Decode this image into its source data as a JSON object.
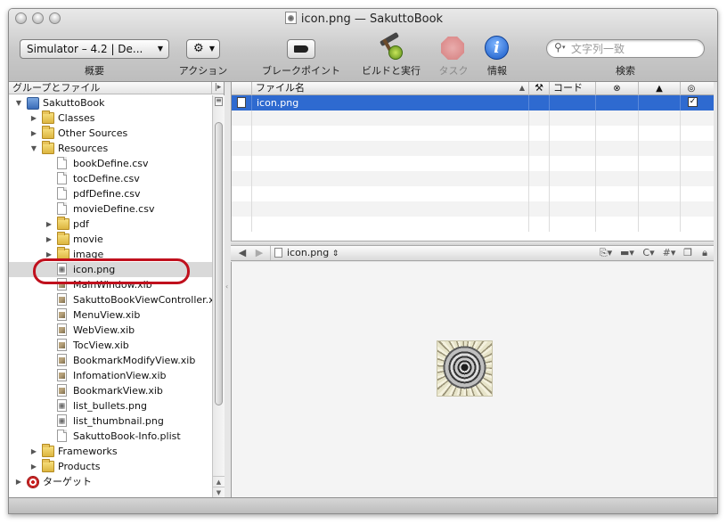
{
  "window": {
    "title": "icon.png — SakuttoBook"
  },
  "toolbar": {
    "scheme_popup": "Simulator – 4.2 | De...",
    "scheme_label": "概要",
    "action_label": "アクション",
    "breakpoints_label": "ブレークポイント",
    "build_run_label": "ビルドと実行",
    "tasks_label": "タスク",
    "info_label": "情報",
    "search_placeholder": "文字列一致",
    "search_label": "検索"
  },
  "sidebar": {
    "header": "グループとファイル",
    "items": [
      {
        "label": "SakuttoBook",
        "kind": "project",
        "indent": 0,
        "disclosure": "open"
      },
      {
        "label": "Classes",
        "kind": "folder",
        "indent": 1,
        "disclosure": "closed"
      },
      {
        "label": "Other Sources",
        "kind": "folder",
        "indent": 1,
        "disclosure": "closed"
      },
      {
        "label": "Resources",
        "kind": "folder",
        "indent": 1,
        "disclosure": "open"
      },
      {
        "label": "bookDefine.csv",
        "kind": "file",
        "indent": 2,
        "disclosure": "none"
      },
      {
        "label": "tocDefine.csv",
        "kind": "file",
        "indent": 2,
        "disclosure": "none"
      },
      {
        "label": "pdfDefine.csv",
        "kind": "file",
        "indent": 2,
        "disclosure": "none"
      },
      {
        "label": "movieDefine.csv",
        "kind": "file",
        "indent": 2,
        "disclosure": "none"
      },
      {
        "label": "pdf",
        "kind": "folder",
        "indent": 2,
        "disclosure": "closed"
      },
      {
        "label": "movie",
        "kind": "folder",
        "indent": 2,
        "disclosure": "closed"
      },
      {
        "label": "image",
        "kind": "folder",
        "indent": 2,
        "disclosure": "closed"
      },
      {
        "label": "icon.png",
        "kind": "img",
        "indent": 2,
        "disclosure": "none",
        "selected": true
      },
      {
        "label": "MainWindow.xib",
        "kind": "xib",
        "indent": 2,
        "disclosure": "none"
      },
      {
        "label": "SakuttoBookViewController.xib",
        "kind": "xib",
        "indent": 2,
        "disclosure": "none"
      },
      {
        "label": "MenuView.xib",
        "kind": "xib",
        "indent": 2,
        "disclosure": "none"
      },
      {
        "label": "WebView.xib",
        "kind": "xib",
        "indent": 2,
        "disclosure": "none"
      },
      {
        "label": "TocView.xib",
        "kind": "xib",
        "indent": 2,
        "disclosure": "none"
      },
      {
        "label": "BookmarkModifyView.xib",
        "kind": "xib",
        "indent": 2,
        "disclosure": "none"
      },
      {
        "label": "InfomationView.xib",
        "kind": "xib",
        "indent": 2,
        "disclosure": "none"
      },
      {
        "label": "BookmarkView.xib",
        "kind": "xib",
        "indent": 2,
        "disclosure": "none"
      },
      {
        "label": "list_bullets.png",
        "kind": "img",
        "indent": 2,
        "disclosure": "none"
      },
      {
        "label": "list_thumbnail.png",
        "kind": "img",
        "indent": 2,
        "disclosure": "none"
      },
      {
        "label": "SakuttoBook-Info.plist",
        "kind": "file",
        "indent": 2,
        "disclosure": "none"
      },
      {
        "label": "Frameworks",
        "kind": "folder",
        "indent": 1,
        "disclosure": "closed"
      },
      {
        "label": "Products",
        "kind": "folder",
        "indent": 1,
        "disclosure": "closed"
      },
      {
        "label": "ターゲット",
        "kind": "target",
        "indent": 0,
        "disclosure": "closed"
      }
    ]
  },
  "file_list": {
    "columns": {
      "filename": "ファイル名",
      "code": "コード"
    },
    "rows": [
      {
        "filename": "icon.png",
        "checked": true
      }
    ]
  },
  "navbar": {
    "file": "icon.png",
    "c_label": "C",
    "hash_label": "#"
  },
  "colors": {
    "selection_blue": "#2e6ad0",
    "highlight_ring": "#c0101d"
  }
}
